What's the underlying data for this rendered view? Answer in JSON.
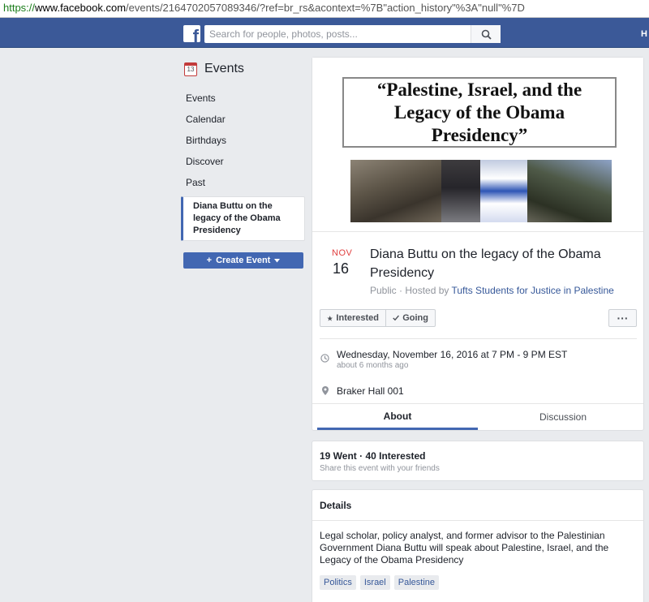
{
  "browser": {
    "url_scheme": "https://",
    "url_host": "www.facebook.com",
    "url_path": "/events/2164702057089346/?ref=br_rs&acontext=%7B\"action_history\"%3A\"null\"%7D"
  },
  "header": {
    "logo_letter": "f",
    "search_placeholder": "Search for people, photos, posts...",
    "right_text": "H"
  },
  "sidebar": {
    "icon_day": "13",
    "title": "Events",
    "items": [
      {
        "label": "Events"
      },
      {
        "label": "Calendar"
      },
      {
        "label": "Birthdays"
      },
      {
        "label": "Discover"
      },
      {
        "label": "Past"
      }
    ],
    "active_item": "Diana Buttu on the legacy of the Obama Presidency",
    "create_button": "Create Event"
  },
  "event": {
    "cover_title": "“Palestine, Israel, and the Legacy of the Obama Presidency”",
    "month": "NOV",
    "day": "16",
    "title": "Diana Buttu on the legacy of the Obama Presidency",
    "privacy": "Public · Hosted by ",
    "host": "Tufts Students for Justice in Palestine",
    "buttons": {
      "interested": "Interested",
      "going": "Going",
      "more": "···"
    },
    "time": "Wednesday, November 16, 2016 at 7 PM - 9 PM EST",
    "time_relative": "about 6 months ago",
    "location": "Braker Hall 001",
    "tabs": [
      "About",
      "Discussion"
    ]
  },
  "attendance": {
    "counts": "19 Went · 40 Interested",
    "share": "Share this event with your friends"
  },
  "details": {
    "heading": "Details",
    "description": "Legal scholar, policy analyst, and former advisor to the Palestinian Government Diana Buttu will speak about Palestine, Israel, and the Legacy of the Obama Presidency",
    "tags": [
      "Politics",
      "Israel",
      "Palestine"
    ]
  },
  "colors": {
    "brand": "#3b5998",
    "button_blue": "#4267b2",
    "month_red": "#e04040",
    "link": "#365899"
  }
}
